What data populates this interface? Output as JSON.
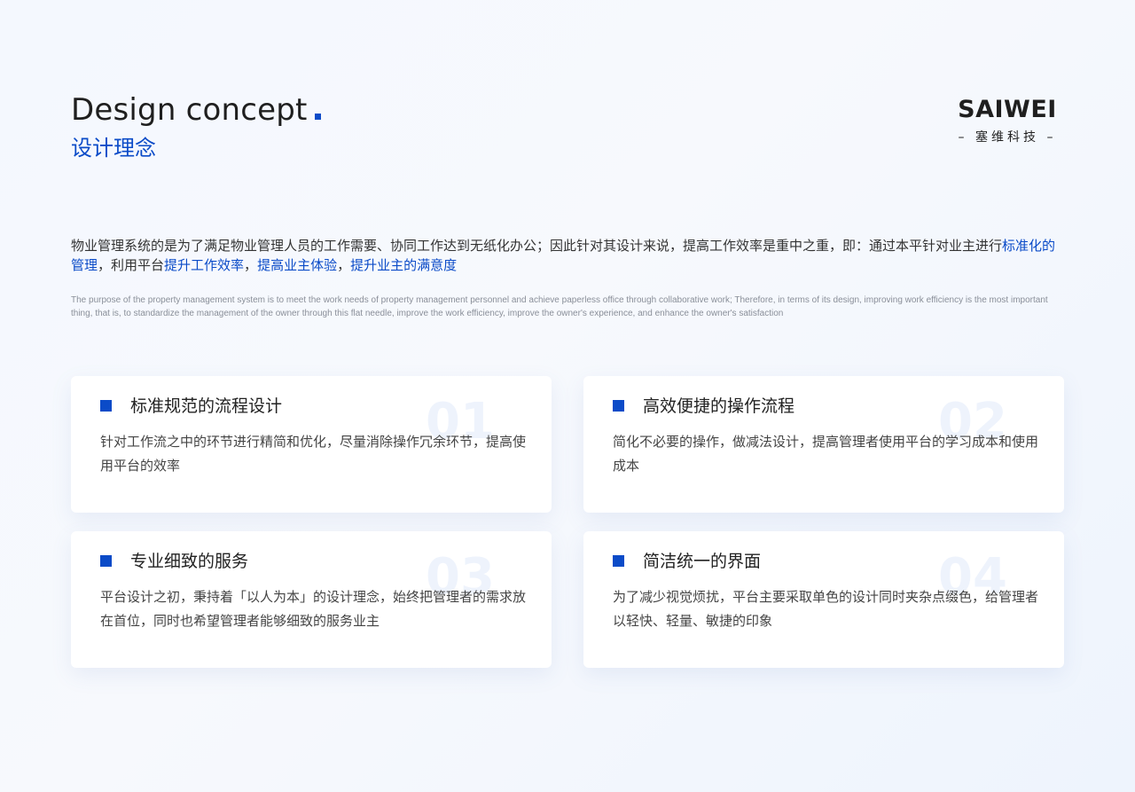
{
  "colors": {
    "accent": "#0b4bc8",
    "background": "#f5f8fe",
    "card": "#ffffff",
    "watermark_number": "#eef3fc"
  },
  "header": {
    "title": "Design concept",
    "subtitle": "设计理念"
  },
  "brand": {
    "name": "SAIWEI",
    "subtitle": "– 塞维科技 –"
  },
  "intro": {
    "cn_part1": "物业管理系统的是为了满足物业管理人员的工作需要、协同工作达到无纸化办公；因此针对其设计来说，提高工作效率是重中之重，即：通过本平针对业主进行",
    "cn_hl1": "标准化的管理",
    "cn_part2": "，利用平台",
    "cn_hl2": "提升工作效率",
    "cn_part3": "，",
    "cn_hl3": "提高业主体验",
    "cn_part4": "，",
    "cn_hl4": "提升业主的满意度",
    "en": "The purpose of the property management system is to meet the work needs of property management personnel and achieve paperless office through collaborative work; Therefore, in terms of its design, improving work efficiency is the most important thing, that is, to standardize the management of the owner through this flat needle, improve the work efficiency, improve the owner's experience, and enhance the owner's satisfaction"
  },
  "cards": [
    {
      "number": "01",
      "title": "标准规范的流程设计",
      "desc": "针对工作流之中的环节进行精简和优化，尽量消除操作冗余环节，提高使用平台的效率"
    },
    {
      "number": "02",
      "title": "高效便捷的操作流程",
      "desc": "简化不必要的操作，做减法设计，提高管理者使用平台的学习成本和使用成本"
    },
    {
      "number": "03",
      "title": "专业细致的服务",
      "desc": "平台设计之初，秉持着「以人为本」的设计理念，始终把管理者的需求放在首位，同时也希望管理者能够细致的服务业主"
    },
    {
      "number": "04",
      "title": "简洁统一的界面",
      "desc": "为了减少视觉烦扰，平台主要采取单色的设计同时夹杂点缀色，给管理者以轻快、轻量、敏捷的印象"
    }
  ]
}
